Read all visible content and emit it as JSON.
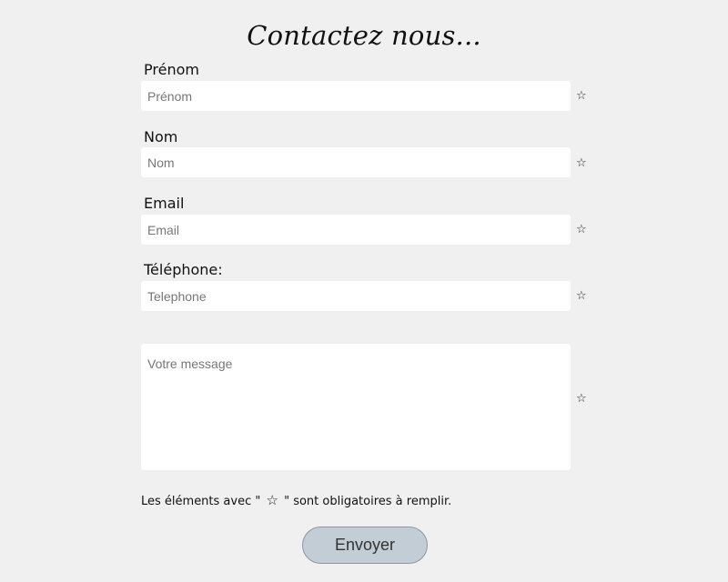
{
  "form": {
    "title": "Contactez nous...",
    "fields": [
      {
        "label": "Prénom",
        "placeholder": "Prénom",
        "value": "",
        "required_icon": "star-outline-icon"
      },
      {
        "label": "Nom",
        "placeholder": "Nom",
        "value": "",
        "required_icon": "star-outline-icon"
      },
      {
        "label": "Email",
        "placeholder": "Email",
        "value": "",
        "required_icon": "star-outline-icon"
      },
      {
        "label": "Téléphone:",
        "placeholder": "Telephone",
        "value": "",
        "required_icon": "star-outline-icon"
      }
    ],
    "message": {
      "placeholder": "Votre message",
      "value": "",
      "required_icon": "star-outline-icon"
    },
    "required_glyph": "☆",
    "note": {
      "before": "Les éléments avec \"",
      "after": "\" sont obligatoires à remplir."
    },
    "submit_label": "Envoyer"
  },
  "colors": {
    "background": "#f0f0f0",
    "field_background": "#ffffff",
    "button_background": "#c2cdd6",
    "button_border": "#8e979f"
  }
}
